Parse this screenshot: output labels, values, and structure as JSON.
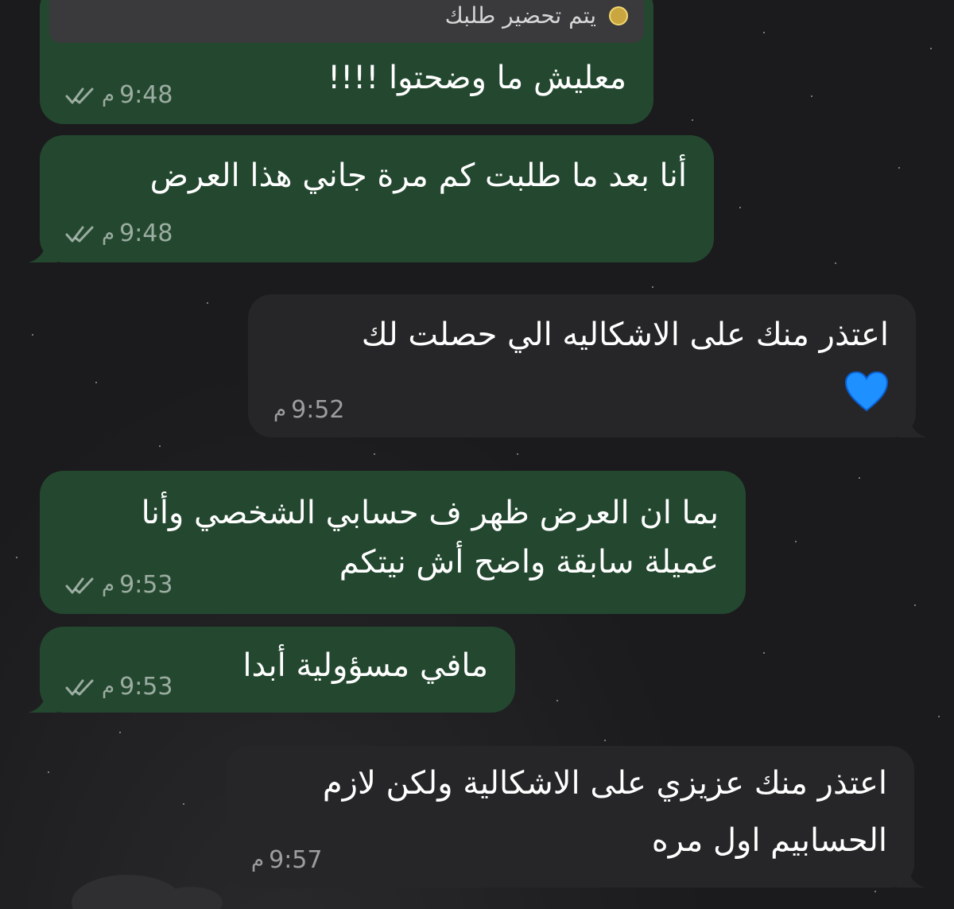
{
  "colors": {
    "background": "#1b1b1d",
    "outgoing_bubble": "#23482f",
    "incoming_bubble": "#262628",
    "meta_text": "rgba(255,255,255,0.55)",
    "heart": "#1e90ff"
  },
  "reply_preview": {
    "text": "يتم تحضير طلبك",
    "icon": "smiling-emoji-icon"
  },
  "messages": [
    {
      "direction": "outgoing",
      "lines": [
        "معليش ما وضحتوا !!!!"
      ],
      "time": "9:48",
      "period": "م",
      "status_icon": "double-check-icon"
    },
    {
      "direction": "outgoing",
      "lines": [
        "أنا بعد ما طلبت كم مرة جاني هذا العرض"
      ],
      "time": "9:48",
      "period": "م",
      "status_icon": "double-check-icon"
    },
    {
      "direction": "incoming",
      "lines": [
        "اعتذر منك على الاشكاليه الي حصلت لك"
      ],
      "emoji": "blue-heart-icon",
      "time": "9:52",
      "period": "م"
    },
    {
      "direction": "outgoing",
      "lines": [
        "بما ان العرض ظهر ف حسابي الشخصي وأنا",
        "عميلة سابقة واضح أش نيتكم"
      ],
      "time": "9:53",
      "period": "م",
      "status_icon": "double-check-icon"
    },
    {
      "direction": "outgoing",
      "lines": [
        "مافي مسؤولية أبدا"
      ],
      "time": "9:53",
      "period": "م",
      "status_icon": "double-check-icon"
    },
    {
      "direction": "incoming",
      "lines": [
        "اعتذر منك عزيزي على الاشكالية ولكن لازم",
        "الحسابيم اول مره"
      ],
      "time": "9:57",
      "period": "م"
    }
  ]
}
